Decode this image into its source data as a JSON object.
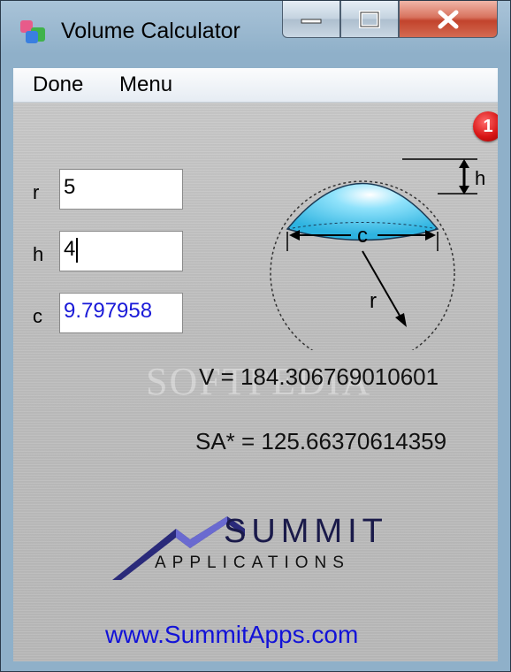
{
  "window": {
    "title": "Volume Calculator",
    "controls": {
      "minimize": "minimize",
      "maximize": "maximize",
      "close": "close"
    }
  },
  "menubar": {
    "items": [
      "Done",
      "Menu"
    ]
  },
  "notification_badge": "1",
  "fields": [
    {
      "label": "r",
      "value": "5"
    },
    {
      "label": "h",
      "value": "4"
    },
    {
      "label": "c",
      "value": "9.797958"
    }
  ],
  "diagram": {
    "labels": {
      "h": "h",
      "c": "c",
      "r": "r"
    }
  },
  "results": {
    "volume": "V = 184.306769010601",
    "surface_area": "SA* = 125.66370614359"
  },
  "watermark": "SOFTPEDIA",
  "logo": {
    "word": "SUMMIT",
    "sub": "APPLICATIONS"
  },
  "website": "www.SummitApps.com",
  "colors": {
    "accent_blue": "#1a1ad8",
    "cap_cyan": "#5fd0f2",
    "badge_red": "#d81616"
  }
}
